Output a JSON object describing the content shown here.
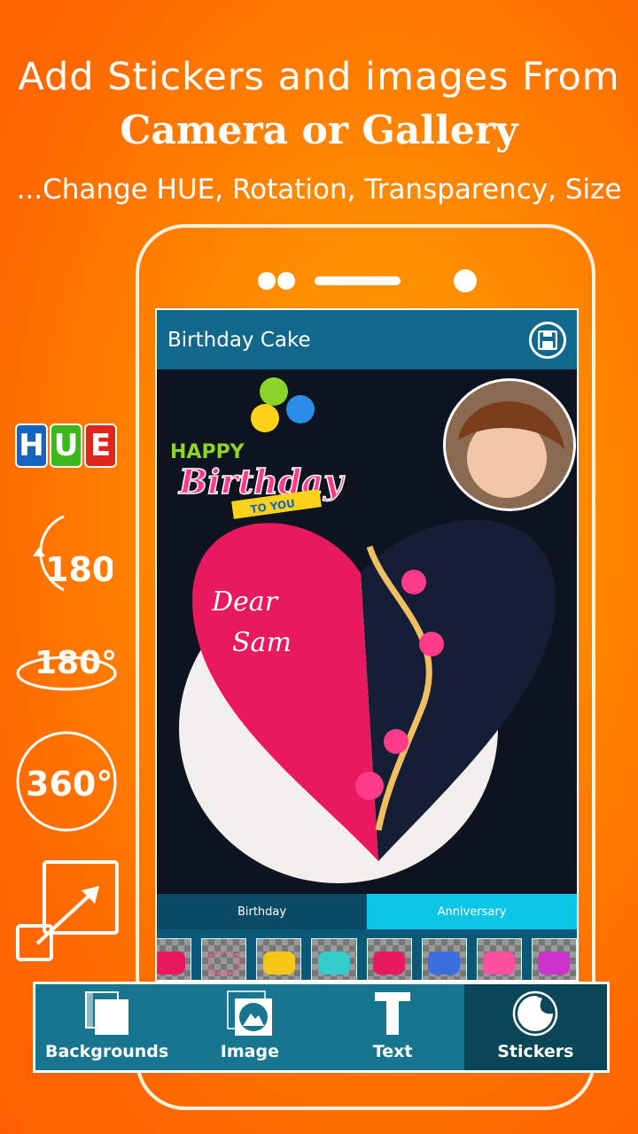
{
  "headline": {
    "line1": "Add Stickers and images From",
    "line2": "Camera or Gallery",
    "line3": "...Change HUE, Rotation, Transparency, Size"
  },
  "features": [
    {
      "icon": "hue-icon",
      "label": "HUE"
    },
    {
      "icon": "rotate-vertical-icon",
      "label": "180°"
    },
    {
      "icon": "rotate-horizontal-icon",
      "label": "180°"
    },
    {
      "icon": "rotate-360-icon",
      "label": "360°"
    },
    {
      "icon": "resize-icon"
    }
  ],
  "app": {
    "title": "Birthday Cake",
    "save_icon": "save-icon",
    "canvas": {
      "sticker_text": {
        "line1": "HAPPY",
        "line2": "Birthday",
        "line3": "TO YOU"
      },
      "cake_text": {
        "line1": "Dear",
        "line2": "Sam"
      }
    },
    "tabs": [
      {
        "label": "Birthday",
        "active": false
      },
      {
        "label": "Anniversary",
        "active": true
      }
    ],
    "nav": [
      {
        "label": "Backgrounds",
        "icon": "backgrounds-icon"
      },
      {
        "label": "Image",
        "icon": "image-icon"
      },
      {
        "label": "Text",
        "icon": "text-icon"
      },
      {
        "label": "Stickers",
        "icon": "stickers-icon",
        "active": true
      }
    ]
  },
  "colors": {
    "appbar": "#10688c",
    "tab_active": "#0bc6e6",
    "nav": "#17758f",
    "nav_active": "#0b4558",
    "background": "#ff7a00"
  }
}
